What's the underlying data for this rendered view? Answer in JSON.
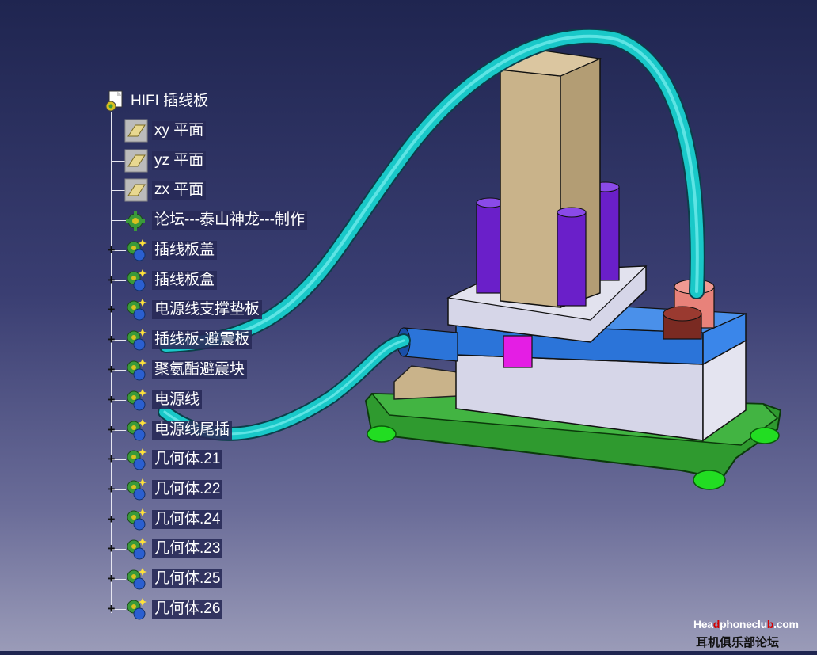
{
  "tree": {
    "root": {
      "label": "HIFI 插线板",
      "icon": "product-gear-icon"
    },
    "nodes": [
      {
        "label": "xy 平面",
        "icon": "plane-icon",
        "expandable": false
      },
      {
        "label": "yz 平面",
        "icon": "plane-icon",
        "expandable": false
      },
      {
        "label": "zx 平面",
        "icon": "plane-icon",
        "expandable": false
      },
      {
        "label": "论坛---泰山神龙---制作",
        "icon": "part-body-icon",
        "expandable": false
      },
      {
        "label": "插线板盖",
        "icon": "geometrical-set-icon",
        "expandable": true
      },
      {
        "label": "插线板盒",
        "icon": "geometrical-set-icon",
        "expandable": true
      },
      {
        "label": "电源线支撑垫板",
        "icon": "geometrical-set-icon",
        "expandable": true
      },
      {
        "label": "插线板-避震板",
        "icon": "geometrical-set-icon",
        "expandable": true
      },
      {
        "label": "聚氨酯避震块",
        "icon": "geometrical-set-icon",
        "expandable": true
      },
      {
        "label": "电源线",
        "icon": "geometrical-set-icon",
        "expandable": true
      },
      {
        "label": "电源线尾插",
        "icon": "geometrical-set-icon",
        "expandable": true
      },
      {
        "label": "几何体.21",
        "icon": "geometrical-set-icon",
        "expandable": true
      },
      {
        "label": "几何体.22",
        "icon": "geometrical-set-icon",
        "expandable": true
      },
      {
        "label": "几何体.24",
        "icon": "geometrical-set-icon",
        "expandable": true
      },
      {
        "label": "几何体.23",
        "icon": "geometrical-set-icon",
        "expandable": true
      },
      {
        "label": "几何体.25",
        "icon": "geometrical-set-icon",
        "expandable": true
      },
      {
        "label": "几何体.26",
        "icon": "geometrical-set-icon",
        "expandable": true
      }
    ]
  },
  "watermark": {
    "pre": "Hea",
    "dmark": "d",
    "mid": "phoneclu",
    "bmark": "b",
    "post": ".com",
    "subtitle": "耳机俱乐部论坛"
  },
  "colors": {
    "background_top": "#1f2550",
    "background_bottom": "#9a9bb8",
    "cable": "#19c8c8",
    "base_plate": "#2f9a2f",
    "feet": "#22dd22",
    "box_band": "#2b74d9",
    "box_body": "#d6d6e8",
    "block": "#c9b38a",
    "posts": "#6a1fc9"
  }
}
